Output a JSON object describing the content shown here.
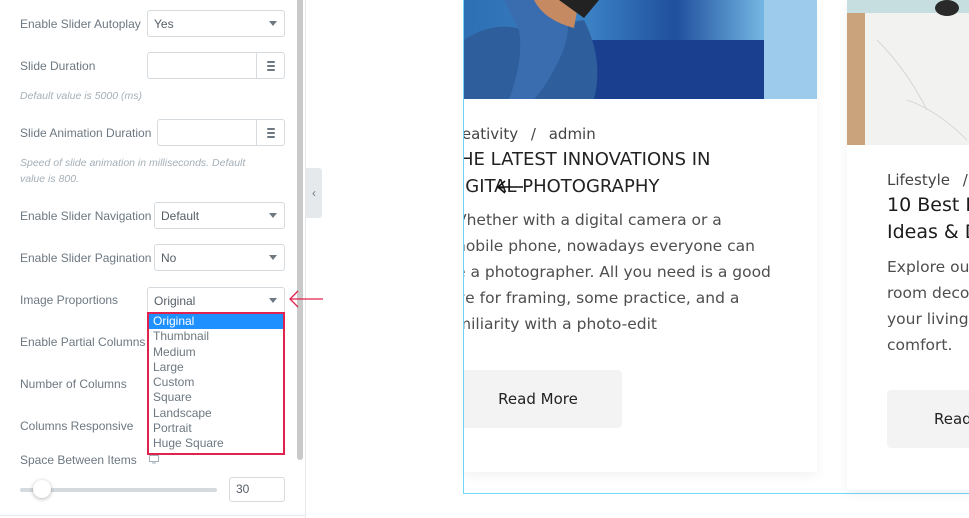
{
  "panel": {
    "fields": {
      "autoplay": {
        "label": "Enable Slider Autoplay",
        "value": "Yes"
      },
      "slide_duration": {
        "label": "Slide Duration",
        "value": "",
        "hint": "Default value is 5000 (ms)",
        "icon": "database-icon"
      },
      "animation_duration": {
        "label": "Slide Animation Duration",
        "value": "",
        "hint": "Speed of slide animation in milliseconds. Default value is 800.",
        "icon": "database-icon"
      },
      "navigation": {
        "label": "Enable Slider Navigation",
        "value": "Default"
      },
      "pagination": {
        "label": "Enable Slider Pagination",
        "value": "No"
      },
      "image_proportions": {
        "label": "Image Proportions",
        "value": "Original",
        "options": [
          "Original",
          "Thumbnail",
          "Medium",
          "Large",
          "Custom",
          "Square",
          "Landscape",
          "Portrait",
          "Huge Square"
        ],
        "selected_index": 0
      },
      "partial_columns": {
        "label": "Enable Partial Columns"
      },
      "num_columns": {
        "label": "Number of Columns"
      },
      "columns_responsive": {
        "label": "Columns Responsive"
      },
      "space_between": {
        "label": "Space Between Items",
        "value": "30",
        "slider_fraction": 0.06,
        "icon": "monitor-icon"
      }
    }
  },
  "colors": {
    "highlight_border": "#e0234e",
    "selected_option": "#1e90ff",
    "preview_outline": "#71d7f7"
  },
  "preview": {
    "cards": [
      {
        "meta_category": "reativity",
        "meta_separator": "/",
        "meta_author": "admin",
        "title_lines": [
          "HE LATEST INNOVATIONS IN",
          "IGITAL PHOTOGRAPHY"
        ],
        "body_lines": [
          "Vhether with a digital camera or a",
          "nobile phone, nowadays everyone can",
          "e a photographer. All you need is a good",
          "ye for framing, some practice, and a",
          "miliarity with a photo-edit"
        ],
        "button": "Read More"
      },
      {
        "meta_category": "Lifestyle",
        "meta_separator": "/",
        "title_lines": [
          "10 Best L",
          "Ideas & D"
        ],
        "body_lines": [
          "Explore ou",
          "room deco",
          "your living",
          "comfort."
        ],
        "button": "Read"
      }
    ]
  }
}
